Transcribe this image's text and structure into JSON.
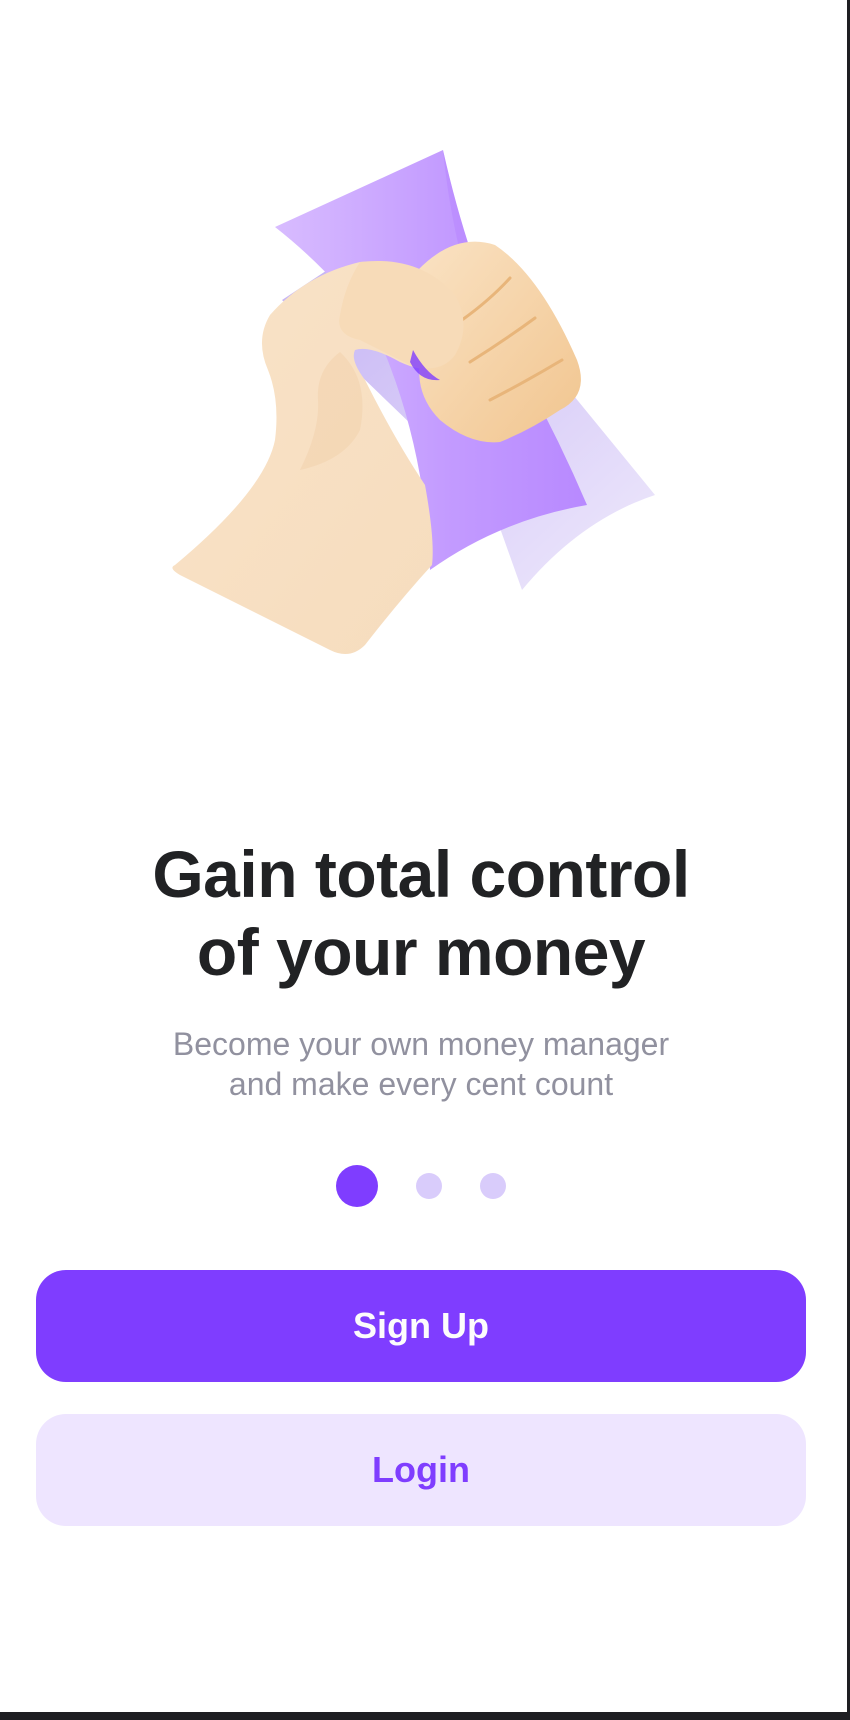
{
  "onboarding": {
    "title_line1": "Gain total control",
    "title_line2": "of your money",
    "subtitle_line1": "Become your own money manager",
    "subtitle_line2": "and make every cent count",
    "illustration": "hand-holding-money-illustration",
    "pagination": {
      "total": 3,
      "active": 1
    }
  },
  "actions": {
    "signup_label": "Sign Up",
    "login_label": "Login"
  },
  "colors": {
    "primary": "#7f3dff",
    "primary_light": "#eee5ff",
    "dot_inactive": "#d9ccfb",
    "title": "#212224",
    "subtitle": "#91919f",
    "bill": "#c49bff",
    "skin": "#f7dfc2"
  }
}
